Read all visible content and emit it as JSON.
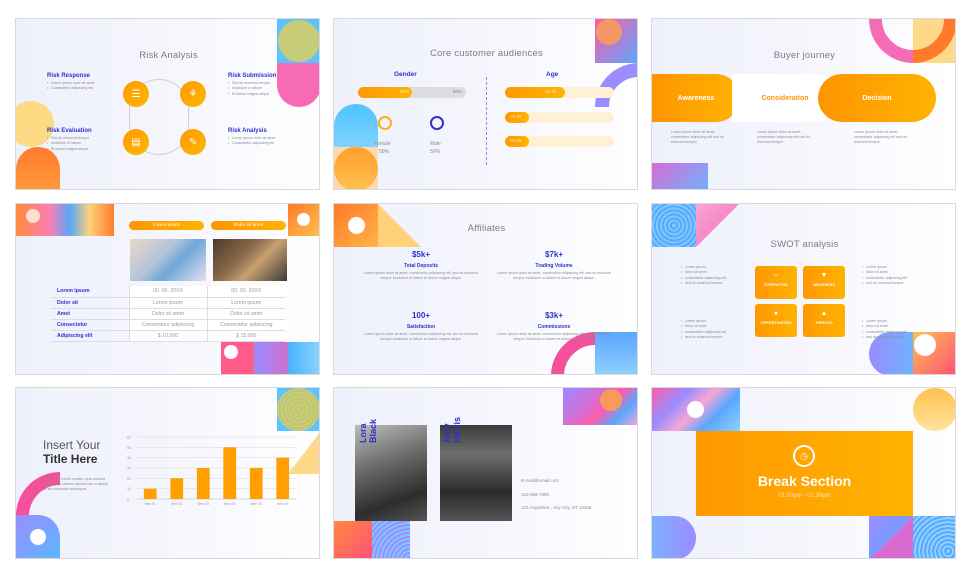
{
  "slides": {
    "risk": {
      "title": "Risk Analysis",
      "blocks": [
        {
          "heading": "Risk Response",
          "bullets": [
            "Lorem ipsum dolor sit amet",
            "Consectetur adipiscing elit"
          ]
        },
        {
          "heading": "Risk Submission",
          "bullets": [
            "Sed do eiusmod tempor",
            "incididunt ut labore",
            "Et dolore magna aliqua"
          ]
        },
        {
          "heading": "Risk Evaluation",
          "bullets": [
            "Sed do eiusmod tempor",
            "incididunt ut labore",
            "Et dolore magna aliqua."
          ]
        },
        {
          "heading": "Risk Analysis",
          "bullets": [
            "Lorem ipsum dolor sit amet",
            "Consectetur adipiscing elit"
          ]
        }
      ],
      "icons": [
        "list-icon",
        "network-icon",
        "browser-icon",
        "document-edit-icon"
      ]
    },
    "audience": {
      "title": "Core customer audiences",
      "gender_heading": "Gender",
      "age_heading": "Age",
      "gender_bar": {
        "female_label": "50%",
        "male_label": "50%",
        "female_fraction": 0.5
      },
      "female_label": "Female",
      "female_value": "50%",
      "male_label": "Male",
      "male_value": "50%",
      "age_bars": [
        {
          "label": "20-35",
          "fraction": 0.55
        },
        {
          "label": "35-50",
          "fraction": 0.22
        },
        {
          "label": "50-65",
          "fraction": 0.22
        }
      ]
    },
    "journey": {
      "title": "Buyer journey",
      "stages": [
        {
          "label": "Awareness",
          "text": "Lorem ipsum dolor sit amet, consectetur adipiscing elit sed do eiusmod tempor"
        },
        {
          "label": "Consideration",
          "text": "Lorem ipsum dolor sit amet, consectetur adipiscing elit sed do eiusmod tempor"
        },
        {
          "label": "Decision",
          "text": "Lorem ipsum dolor sit amet, consectetur adipiscing elit sed do eiusmod tempor"
        }
      ]
    },
    "comparison": {
      "column_headers": [
        "Lorem ipsum",
        "Dolor sit amet"
      ],
      "rows": [
        {
          "key": "Lorem ipsum",
          "a": "00. 00. 20XX",
          "b": "00. 00. 20XX"
        },
        {
          "key": "Dolor sit",
          "a": "Lorem ipsum",
          "b": "Lorem ipsum"
        },
        {
          "key": "Amet",
          "a": "Dolor sit amet",
          "b": "Dolor sit amet"
        },
        {
          "key": "Consectetur",
          "a": "Consectetur adipiscing",
          "b": "Consectetur adipiscing"
        },
        {
          "key": "Adipiscing elit",
          "a": "$ 10,000",
          "b": "$ 15,000"
        }
      ]
    },
    "affiliates": {
      "title": "Affiliates",
      "stats": [
        {
          "value": "$5k+",
          "label": "Total Deposits",
          "text": "Lorem ipsum dolor sit amet, consectetur adipiscing elit, sed do eiusmod tempor incididunt ut labore et dolore magna aliqua."
        },
        {
          "value": "$7k+",
          "label": "Trading Volume",
          "text": "Lorem ipsum dolor sit amet, consectetur adipiscing elit, sed do eiusmod tempor incididunt ut labore et dolore magna aliqua."
        },
        {
          "value": "100+",
          "label": "Satisfaction",
          "text": "Lorem ipsum dolor sit amet, consectetur adipiscing elit, sed do eiusmod tempor incididunt ut labore et dolore magna aliqua."
        },
        {
          "value": "$3k+",
          "label": "Commissions",
          "text": "Lorem ipsum dolor sit amet, consectetur adipiscing elit, sed do eiusmod tempor incididunt ut labore et dolore magna aliqua."
        }
      ]
    },
    "swot": {
      "title": "SWOT analysis",
      "boxes": [
        {
          "label": "STRENGTHS",
          "icon": "dumbbell-icon",
          "glyph": "⇔"
        },
        {
          "label": "WEAKNESS",
          "icon": "thumbs-down-icon",
          "glyph": "▼"
        },
        {
          "label": "OPPORTUNITIES",
          "icon": "lightbulb-icon",
          "glyph": "●"
        },
        {
          "label": "THREATS",
          "icon": "warning-icon",
          "glyph": "▲"
        }
      ],
      "bullets": [
        "Lorem ipsum",
        "dolor sit amet",
        "consectetur adipiscing elit",
        "sed do eiusmod tempor"
      ]
    },
    "chart": {
      "title_line1": "Insert Your",
      "title_line2": "Title Here",
      "text": "Ut enim ad minim veniam, quis nostrud exercitation ullamco laboris nisi ut aliquip ex ea commodo consequat."
    },
    "team": {
      "members": [
        {
          "first": "Lora",
          "last": "Black"
        },
        {
          "first": "Amy",
          "last": "Harris"
        }
      ],
      "email": "E-mail@email.com",
      "phone": "123-456-7890",
      "address": "123 Anywhere , Any City, ST 12345"
    },
    "break": {
      "title": "Break Section",
      "time": "01:00pm - 01:30pm"
    }
  },
  "chart_data": {
    "type": "bar",
    "categories": [
      "Item 01",
      "Item 02",
      "Item 03",
      "Item 04",
      "Item 05",
      "Item 06"
    ],
    "values": [
      10,
      20,
      30,
      50,
      30,
      40
    ],
    "title": "",
    "xlabel": "",
    "ylabel": "",
    "ylim": [
      0,
      60
    ],
    "yticks": [
      0,
      10,
      20,
      30,
      40,
      50,
      60
    ],
    "grid": true,
    "bar_color": "#ffa000"
  },
  "colors": {
    "accent_orange": "#ff9800",
    "heading_blue": "#2f2fcf",
    "text_gray": "#8a8a94"
  }
}
